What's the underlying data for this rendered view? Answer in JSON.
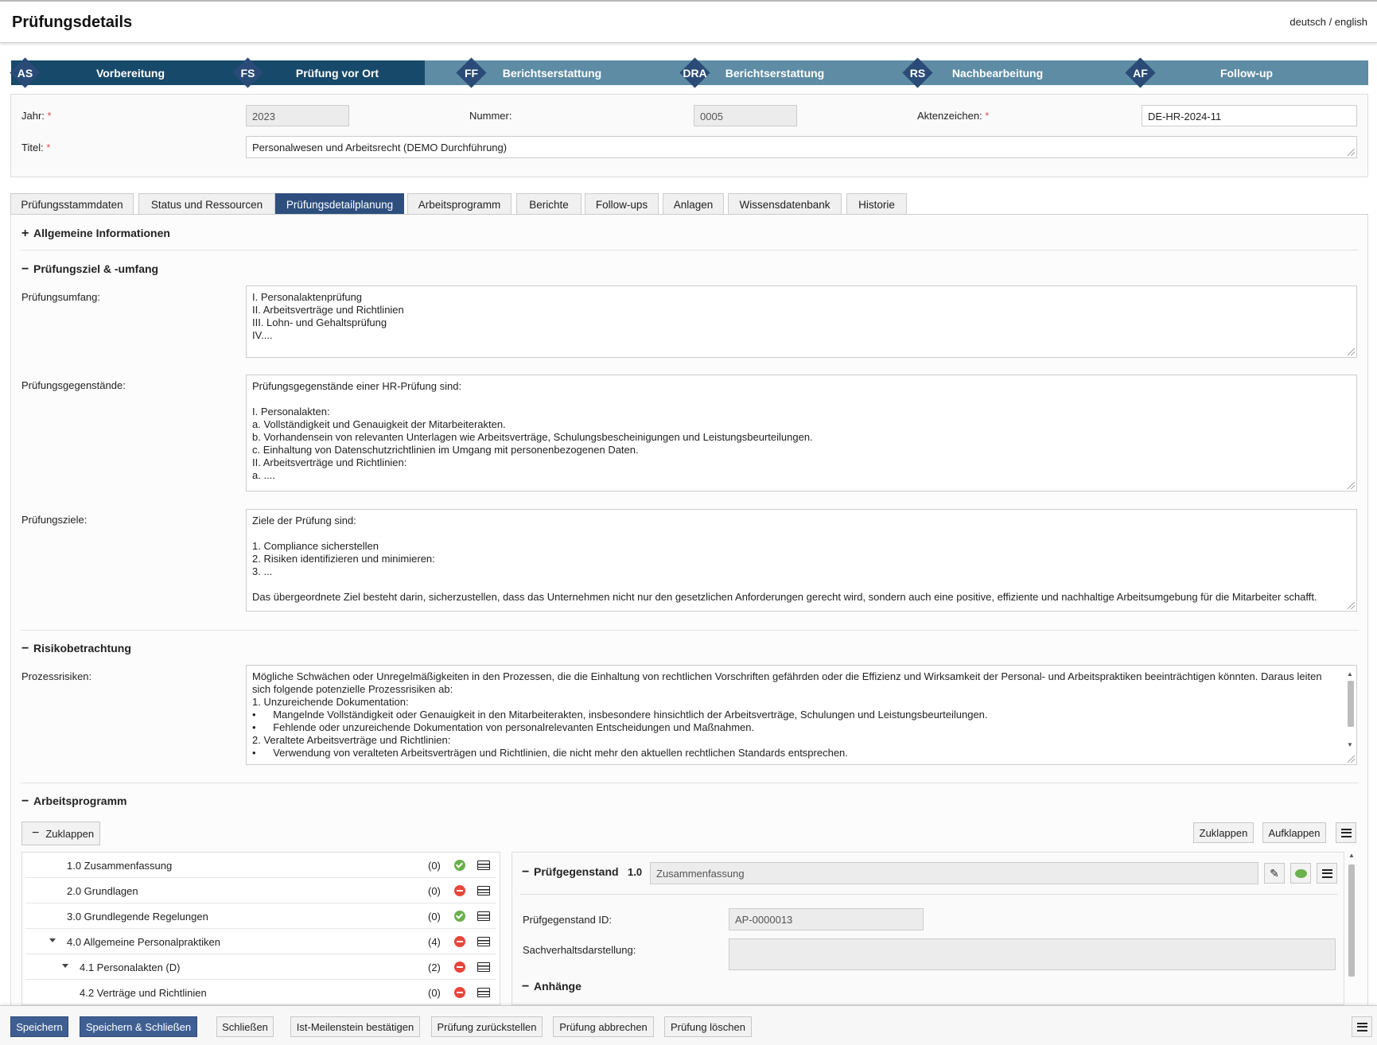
{
  "header": {
    "title": "Prüfungsdetails",
    "lang_de": "deutsch",
    "lang_sep": " / ",
    "lang_en": "english"
  },
  "milestones": [
    {
      "code": "AS",
      "label": "Vorbereitung",
      "state": "done"
    },
    {
      "code": "FS",
      "label": "Prüfung vor Ort",
      "state": "done"
    },
    {
      "code": "FF",
      "label": "Berichtserstattung",
      "state": "open"
    },
    {
      "code": "DRA",
      "label": "Berichtserstattung",
      "state": "open"
    },
    {
      "code": "RS",
      "label": "Nachbearbeitung",
      "state": "open"
    },
    {
      "code": "AF",
      "label": "Follow-up",
      "state": "open"
    }
  ],
  "form": {
    "year_label": "Jahr:",
    "year_value": "2023",
    "number_label": "Nummer:",
    "number_value": "0005",
    "file_label": "Aktenzeichen:",
    "file_value": "DE-HR-2024-11",
    "title_label": "Titel:",
    "title_value": "Personalwesen und Arbeitsrecht (DEMO Durchführung)",
    "required_mark": "*"
  },
  "tabs": [
    "Prüfungsstammdaten",
    "Status und Ressourcen",
    "Prüfungsdetailplanung",
    "Arbeitsprogramm",
    "Berichte",
    "Follow-ups",
    "Anlagen",
    "Wissensdatenbank",
    "Historie"
  ],
  "active_tab": "Prüfungsdetailplanung",
  "sections": {
    "general": {
      "toggle": "+",
      "title": "Allgemeine Informationen"
    },
    "scope": {
      "toggle": "−",
      "title": "Prüfungsziel & -umfang",
      "scope_label": "Prüfungsumfang:",
      "scope_text": "I. Personalaktenprüfung\nII. Arbeitsverträge und Richtlinien\nIII. Lohn- und Gehaltsprüfung\nIV....",
      "subjects_label": "Prüfungsgegenstände:",
      "subjects_text": "Prüfungsgegenstände einer HR-Prüfung sind:\n\nI. Personalakten:\na. Vollständigkeit und Genauigkeit der Mitarbeiterakten.\nb. Vorhandensein von relevanten Unterlagen wie Arbeitsverträge, Schulungsbescheinigungen und Leistungsbeurteilungen.\nc. Einhaltung von Datenschutzrichtlinien im Umgang mit personenbezogenen Daten.\nII. Arbeitsverträge und Richtlinien:\na. ....",
      "goals_label": "Prüfungsziele:",
      "goals_text": "Ziele der Prüfung sind:\n\n1. Compliance sicherstellen\n2. Risiken identifizieren und minimieren:\n3. ...\n\nDas übergeordnete Ziel besteht darin, sicherzustellen, dass das Unternehmen nicht nur den gesetzlichen Anforderungen gerecht wird, sondern auch eine positive, effiziente und nachhaltige Arbeitsumgebung für die Mitarbeiter schafft."
    },
    "risk": {
      "toggle": "−",
      "title": "Risikobetrachtung",
      "process_label": "Prozessrisiken:",
      "process_text": "Mögliche Schwächen oder Unregelmäßigkeiten in den Prozessen, die die Einhaltung von rechtlichen Vorschriften gefährden oder die Effizienz und Wirksamkeit der Personal- und Arbeitspraktiken beeinträchtigen könnten. Daraus leiten sich folgende potenzielle Prozessrisiken ab:\n1. Unzureichende Dokumentation:\n•      Mangelnde Vollständigkeit oder Genauigkeit in den Mitarbeiterakten, insbesondere hinsichtlich der Arbeitsverträge, Schulungen und Leistungsbeurteilungen.\n•      Fehlende oder unzureichende Dokumentation von personalrelevanten Entscheidungen und Maßnahmen.\n2. Veraltete Arbeitsverträge und Richtlinien:\n•      Verwendung von veralteten Arbeitsverträgen und Richtlinien, die nicht mehr den aktuellen rechtlichen Standards entsprechen.\n•"
    },
    "program": {
      "toggle": "−",
      "title": "Arbeitsprogramm",
      "collapse_all": "Zuklappen",
      "collapse_btn": "Zuklappen",
      "expand_btn": "Aufklappen"
    }
  },
  "tree": [
    {
      "label": "1.0 Zusammenfassung",
      "count": "(0)",
      "status": "ok",
      "indent": 0,
      "expander": false
    },
    {
      "label": "2.0 Grundlagen",
      "count": "(0)",
      "status": "no",
      "indent": 0,
      "expander": false
    },
    {
      "label": "3.0 Grundlegende Regelungen",
      "count": "(0)",
      "status": "ok",
      "indent": 0,
      "expander": false
    },
    {
      "label": "4.0 Allgemeine Personalpraktiken",
      "count": "(4)",
      "status": "no",
      "indent": 0,
      "expander": true
    },
    {
      "label": "4.1 Personalakten (D)",
      "count": "(2)",
      "status": "no",
      "indent": 1,
      "expander": true
    },
    {
      "label": "4.2 Verträge und Richtlinien",
      "count": "(0)",
      "status": "no",
      "indent": 1,
      "expander": false
    }
  ],
  "detail": {
    "toggle": "−",
    "heading": "Prüfgegenstand",
    "number": "1.0",
    "name": "Zusammenfassung",
    "id_label": "Prüfgegenstand ID:",
    "id_value": "AP-0000013",
    "facts_label": "Sachverhaltsdarstellung:",
    "facts_value": "",
    "attachments_toggle": "−",
    "attachments_title": "Anhänge"
  },
  "footer": {
    "save": "Speichern",
    "save_close": "Speichern & Schließen",
    "close": "Schließen",
    "confirm_milestone": "Ist-Meilenstein bestätigen",
    "postpone": "Prüfung zurückstellen",
    "cancel": "Prüfung abbrechen",
    "delete": "Prüfung löschen"
  },
  "colors": {
    "accent": "#2e4f7d",
    "milestone_done": "#17496a",
    "milestone_open": "#5d8ca4",
    "ok": "#6ab04c",
    "error": "#e8463b"
  }
}
